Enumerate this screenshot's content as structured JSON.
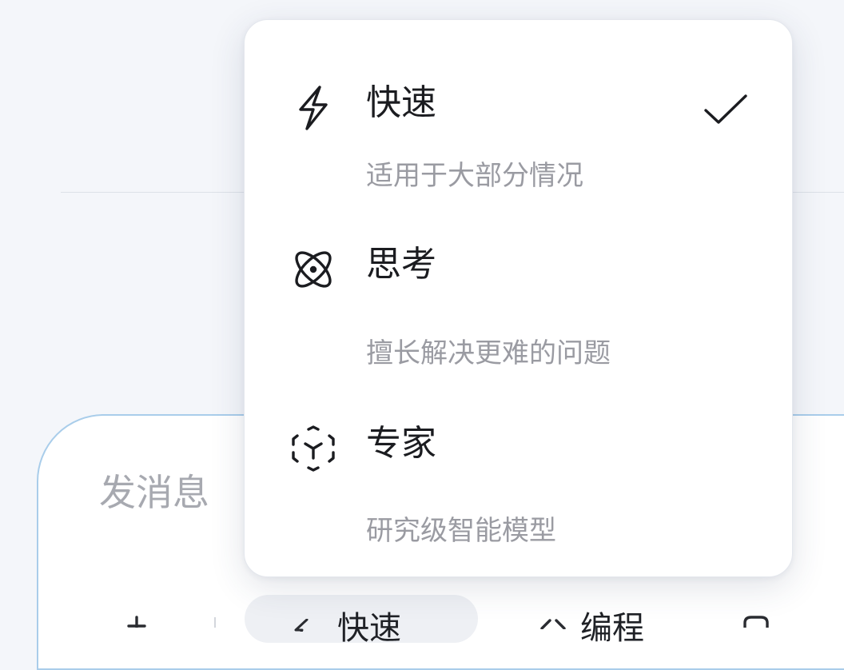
{
  "composer": {
    "placeholder": "发消息"
  },
  "bottom_bar": {
    "mode_label": "快速",
    "code_label": "编程"
  },
  "model_menu": {
    "selected": "快速",
    "items": [
      {
        "title": "快速",
        "description": "适用于大部分情况",
        "icon": "lightning-icon",
        "selected": true
      },
      {
        "title": "思考",
        "description": "擅长解决更难的问题",
        "icon": "atom-icon",
        "selected": false
      },
      {
        "title": "专家",
        "description": "研究级智能模型",
        "icon": "cube-icon",
        "selected": false
      }
    ]
  },
  "colors": {
    "background": "#f4f6fa",
    "menu_background": "#ffffff",
    "title_text": "#1b1c20",
    "secondary_text": "#9a9ba2",
    "composer_border": "#a9cdea"
  }
}
